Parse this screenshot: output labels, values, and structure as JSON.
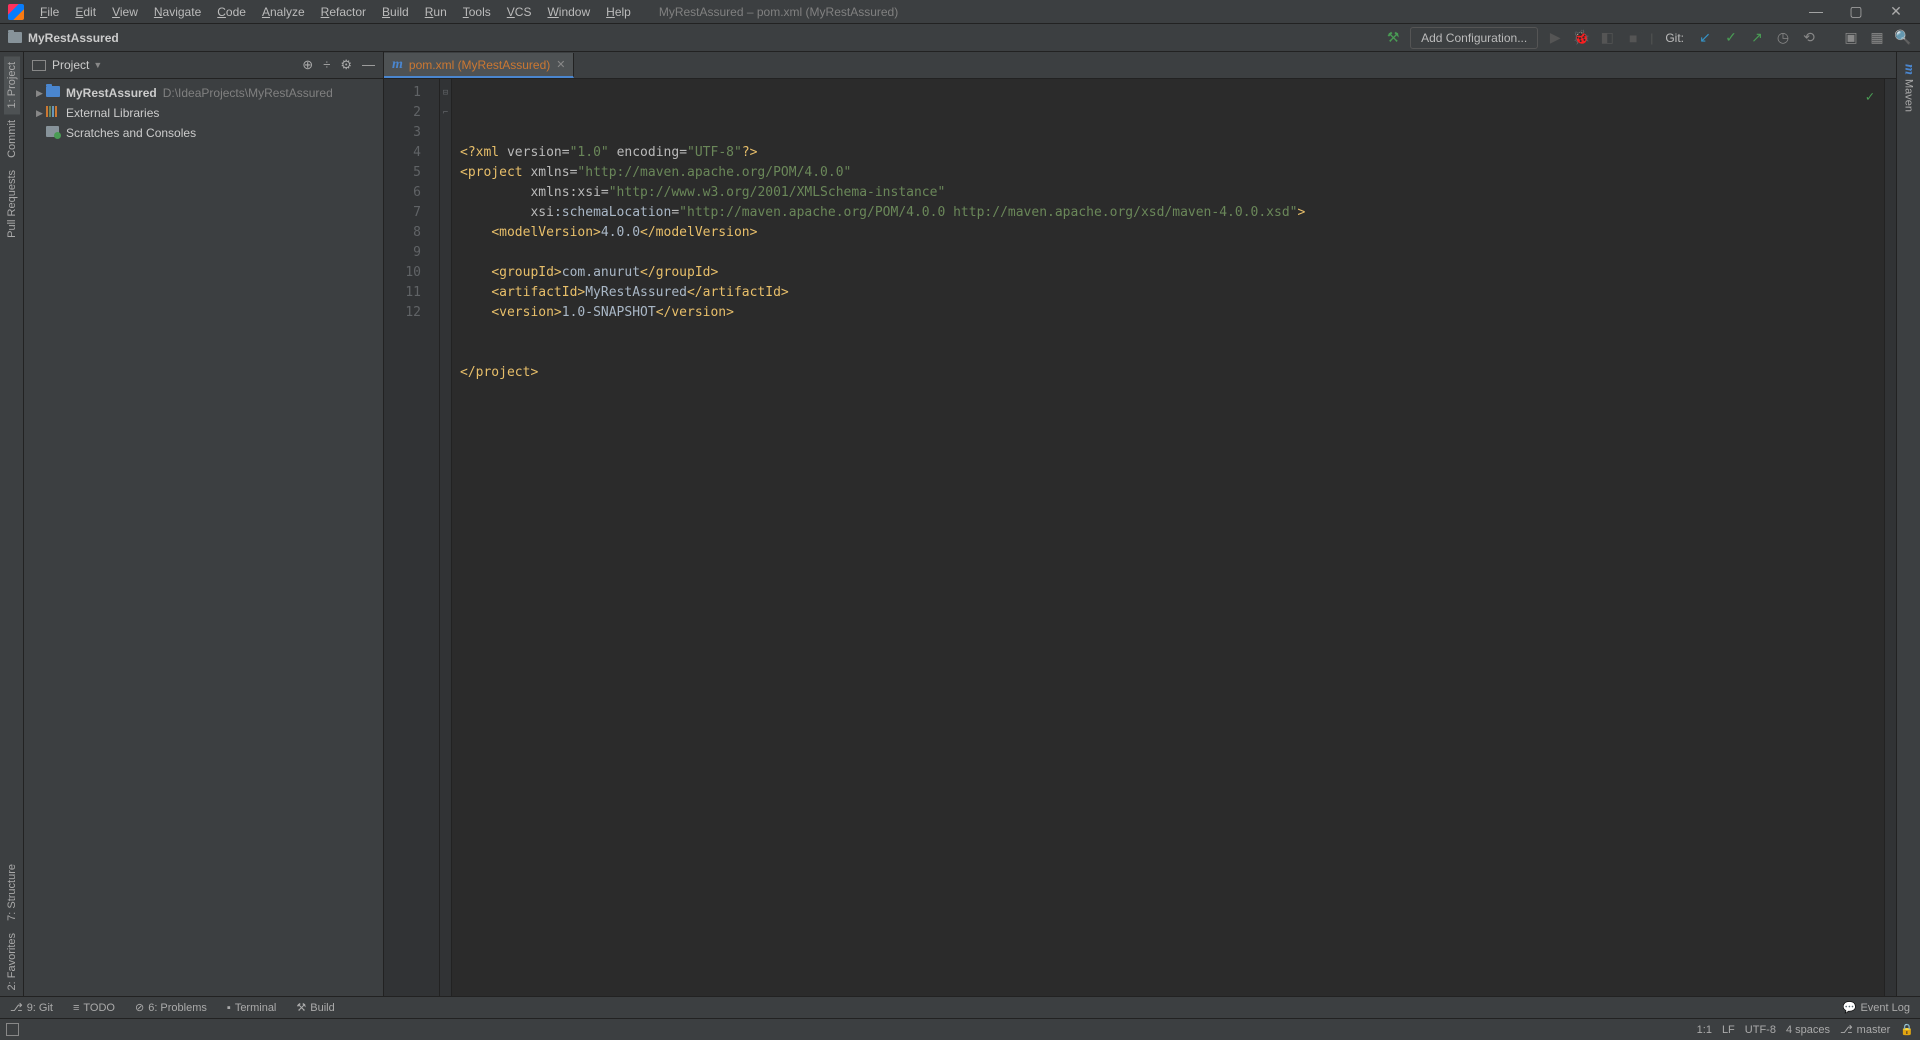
{
  "menu": {
    "items": [
      "File",
      "Edit",
      "View",
      "Navigate",
      "Code",
      "Analyze",
      "Refactor",
      "Build",
      "Run",
      "Tools",
      "VCS",
      "Window",
      "Help"
    ],
    "title": "MyRestAssured – pom.xml (MyRestAssured)"
  },
  "nav": {
    "project": "MyRestAssured",
    "config_label": "Add Configuration...",
    "git_label": "Git:"
  },
  "project_panel": {
    "title": "Project",
    "tree": {
      "root_name": "MyRestAssured",
      "root_path": "D:\\IdeaProjects\\MyRestAssured",
      "ext_libs": "External Libraries",
      "scratches": "Scratches and Consoles"
    }
  },
  "tab": {
    "label": "pom.xml (MyRestAssured)"
  },
  "editor": {
    "line_count": 12,
    "lines": [
      {
        "n": 1,
        "html": "<span class='t-tag'>&lt;?xml</span> <span class='t-attr'>version</span>=<span class='t-str'>\"1.0\"</span> <span class='t-attr'>encoding</span>=<span class='t-str'>\"UTF-8\"</span><span class='t-tag'>?&gt;</span>"
      },
      {
        "n": 2,
        "html": "<span class='t-tag'>&lt;project</span> <span class='t-attr'>xmlns</span>=<span class='t-str'>\"http://maven.apache.org/POM/4.0.0\"</span>"
      },
      {
        "n": 3,
        "html": "         <span class='t-attr'>xmlns:</span><span class='t-attr'>xsi</span>=<span class='t-str'>\"http://www.w3.org/2001/XMLSchema-instance\"</span>"
      },
      {
        "n": 4,
        "html": "         <span class='t-attr'>xsi</span><span class='t-txt'>:schemaLocation</span>=<span class='t-str'>\"http://maven.apache.org/POM/4.0.0 http://maven.apache.org/xsd/maven-4.0.0.xsd\"</span><span class='t-tag'>&gt;</span>"
      },
      {
        "n": 5,
        "html": "    <span class='t-tag'>&lt;modelVersion&gt;</span><span class='t-txt'>4.0.0</span><span class='t-tag'>&lt;/modelVersion&gt;</span>"
      },
      {
        "n": 6,
        "html": ""
      },
      {
        "n": 7,
        "html": "    <span class='t-tag'>&lt;groupId&gt;</span><span class='t-txt'>com.anurut</span><span class='t-tag'>&lt;/groupId&gt;</span>"
      },
      {
        "n": 8,
        "html": "    <span class='t-tag'>&lt;artifactId&gt;</span><span class='t-txt'>MyRestAssured</span><span class='t-tag'>&lt;/artifactId&gt;</span>"
      },
      {
        "n": 9,
        "html": "    <span class='t-tag'>&lt;version&gt;</span><span class='t-txt'>1.0-SNAPSHOT</span><span class='t-tag'>&lt;/version&gt;</span>"
      },
      {
        "n": 10,
        "html": ""
      },
      {
        "n": 11,
        "html": ""
      },
      {
        "n": 12,
        "html": "<span class='t-tag'>&lt;/project&gt;</span>"
      }
    ]
  },
  "left_sidebar": {
    "top": [
      "1: Project",
      "Commit",
      "Pull Requests"
    ],
    "bottom": [
      "7: Structure",
      "2: Favorites"
    ]
  },
  "right_sidebar": {
    "maven": "Maven"
  },
  "bottom_bar": {
    "items": [
      "9: Git",
      "TODO",
      "6: Problems",
      "Terminal",
      "Build"
    ],
    "event_log": "Event Log"
  },
  "status": {
    "pos": "1:1",
    "le": "LF",
    "enc": "UTF-8",
    "indent": "4 spaces",
    "branch": "master"
  }
}
